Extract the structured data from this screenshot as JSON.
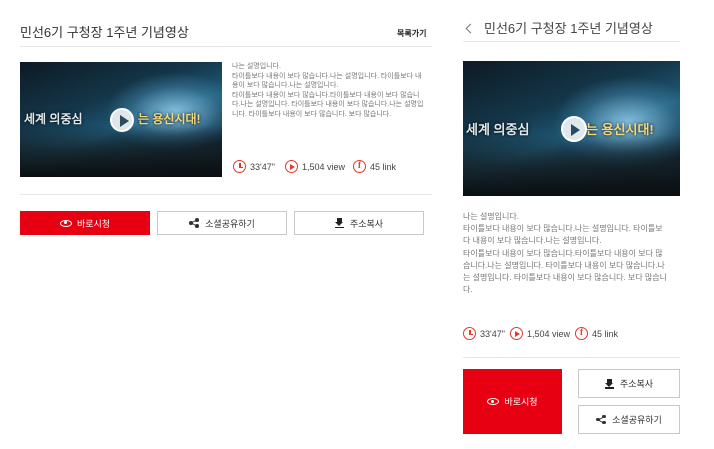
{
  "desktop": {
    "title": "민선6기 구청장 1주년 기념영상",
    "list_link": "목록가기",
    "thumbnail": {
      "caption_left": "세계 의중심",
      "caption_right": "는 용신시대!"
    },
    "description": [
      "나는 설명입니다.",
      "타이틀보다 내용이 보다 많습니다.나는 설명입니다. 타이틀보다 내",
      "용이 보다 많습니다.나는 설명입니다.",
      "타이틀보다 내용이 보다 많습니다.타이틀보다 내용이 보다 많습니",
      "다.나는 설명입니다. 타이틀보다 내용이 보다 많습니다.나는 설명입",
      "니다. 타이틀보다 내용이 보다 많습니다. 보다 많습니다."
    ],
    "stats": {
      "duration": "33'47\"",
      "views": "1,504 view",
      "links": "45 link"
    },
    "buttons": {
      "watch": "바로시청",
      "share": "소셜공유하기",
      "copy": "주소복사"
    }
  },
  "mobile": {
    "title": "민선6기 구청장 1주년 기념영상",
    "thumbnail": {
      "caption_left": "세계 의중심",
      "caption_right": "는 용신시대!"
    },
    "description": [
      "나는 설명입니다.",
      "타이틀보다 내용이 보다 많습니다.나는 설명입니다. 타이틀보",
      "다 내용이 보다 많습니다.나는 설명입니다.",
      "타이틀보다 내용이 보다 많습니다.타이틀보다 내용이 보다 많",
      "습니다.나는 설명입니다. 타이틀보다 내용이 보다 많습니다.나",
      "는 설명입니다. 타이틀보다 내용이 보다 많습니다. 보다 많습니",
      "다."
    ],
    "stats": {
      "duration": "33'47\"",
      "views": "1,504 view",
      "links": "45 link"
    },
    "buttons": {
      "watch": "바로시청",
      "copy": "주소복사",
      "share": "소셜공유하기"
    }
  },
  "icons": [
    "back-icon",
    "clock-icon",
    "play-icon",
    "facebook-icon",
    "eye-icon",
    "share-icon",
    "download-icon"
  ],
  "colors": {
    "accent": "#e60012",
    "icon": "#e03a2a",
    "border": "#c8c8c8"
  }
}
